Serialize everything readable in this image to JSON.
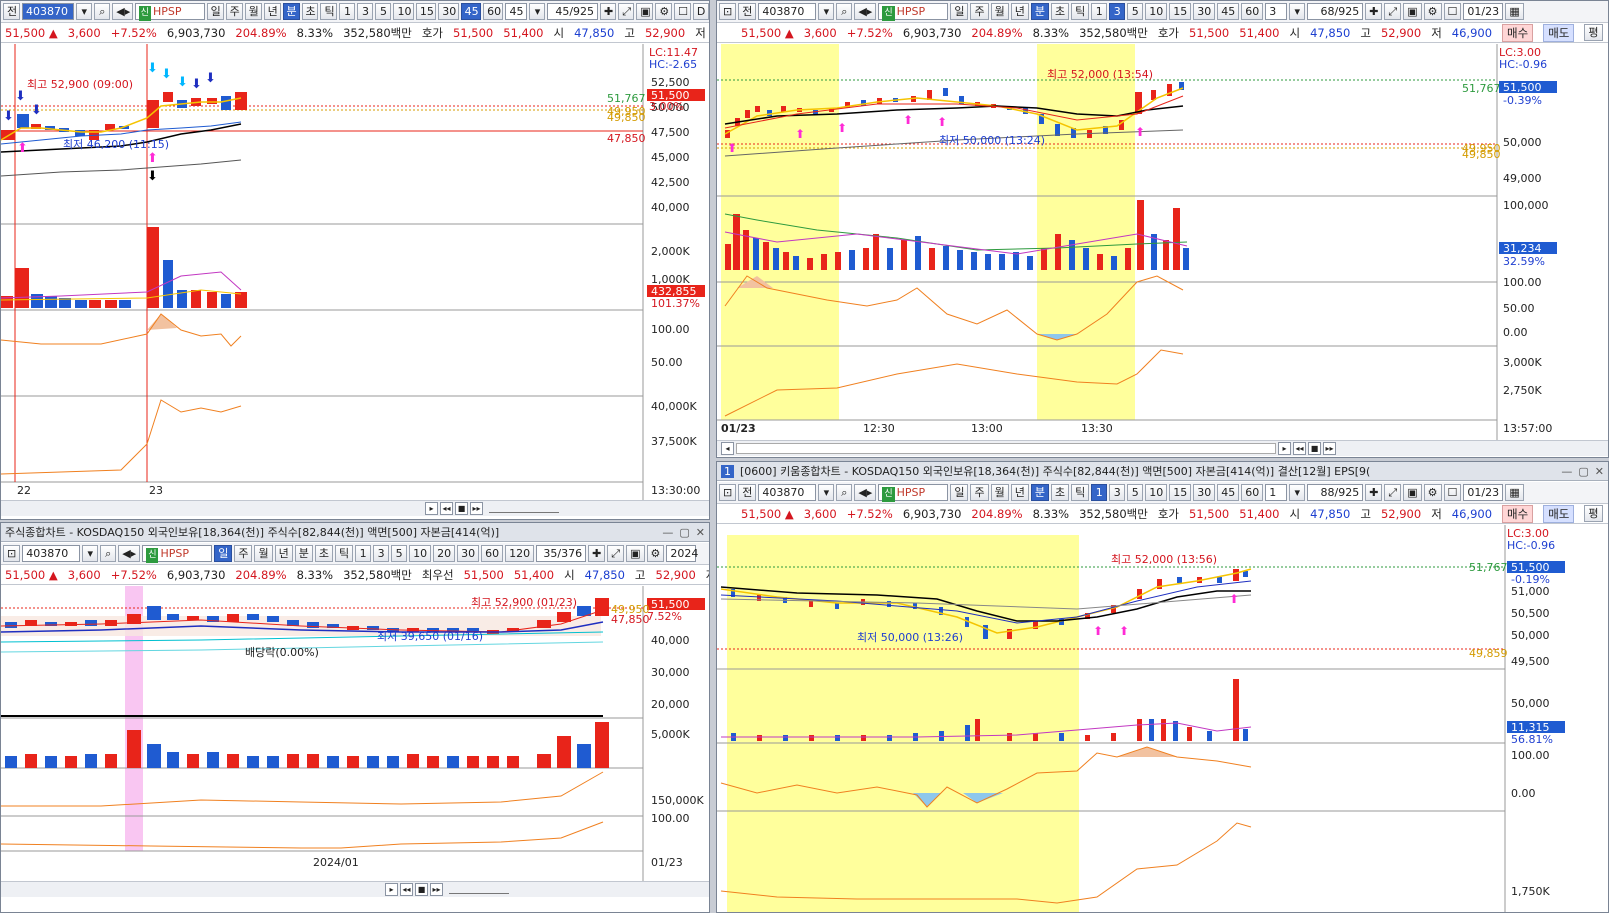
{
  "common": {
    "code": "403870",
    "name": "HPSP",
    "price": "51,500 ▲",
    "change": "3,600",
    "change_pct": "+7.52%",
    "volume": "6,903,730",
    "vol_ratio": "204.89%",
    "turnover_pct": "8.33%",
    "amount": "352,580백만",
    "quote_label": "호가",
    "best_ask": "51,500",
    "best_bid": "51,400",
    "open_label": "시",
    "open": "47,850",
    "high_label": "고",
    "high": "52,900",
    "low_label": "저",
    "low": "46,900",
    "buy": "매수",
    "sell": "매도",
    "flat": "평"
  },
  "tb": {
    "prev": "전",
    "day": "일",
    "week": "주",
    "month": "월",
    "year": "년",
    "minute": "분",
    "second": "초",
    "tick": "틱",
    "b1": "1",
    "b3": "3",
    "b5": "5",
    "b10": "10",
    "b15": "15",
    "b20": "20",
    "b30": "30",
    "b45": "45",
    "b60": "60",
    "b120": "120"
  },
  "pane_tl": {
    "interval": "45",
    "count": "45/925",
    "axis_info": [
      "LC:11.47",
      "HC:-2.65"
    ],
    "annot_high": "최고 52,900 (09:00)",
    "annot_low": "최저 46,200 (11:15)",
    "price_ticks": [
      "52,500",
      "50,000",
      "47,500",
      "45,000",
      "42,500",
      "40,000"
    ],
    "pr_labels": {
      "ma": "51,767",
      "cur": "51,500",
      "pct": "3.00%",
      "open1": "49,950",
      "open2": "49,850",
      "low": "47,850"
    },
    "vol_ticks": [
      "2,000K",
      "1,000K"
    ],
    "vol_labels": {
      "v": "432,855",
      "pct": "101.37%"
    },
    "osc_ticks": [
      "100.00",
      "50.00"
    ],
    "obv_ticks": [
      "40,000K",
      "37,500K"
    ],
    "dates": [
      "22",
      "23"
    ],
    "time": "13:30:00"
  },
  "pane_tr": {
    "interval": "3",
    "count": "68/925",
    "date": "01/23",
    "axis_info": [
      "LC:3.00",
      "HC:-0.96"
    ],
    "annot_high": "최고 52,000 (13:54)",
    "annot_low": "최저 50,000 (13:24)",
    "price_ticks": [
      "50,000",
      "49,000"
    ],
    "pr_labels": {
      "ma": "51,767",
      "cur": "51,500",
      "pct": "-0.39%",
      "l1": "49,950",
      "l2": "49,850"
    },
    "vol_ticks": [
      "100,000",
      "50,000"
    ],
    "vol_labels": {
      "v": "31,234",
      "pct": "32.59%"
    },
    "osc_ticks": [
      "100.00",
      "50.00",
      "0.00"
    ],
    "obv_ticks": [
      "3,000K",
      "2,750K"
    ],
    "xticks": [
      "01/23",
      "12:30",
      "13:00",
      "13:30"
    ],
    "time": "13:57:00"
  },
  "pane_bl": {
    "title": "주식종합차트 - KOSDAQ150 외국인보유[18,364(천)] 주식수[82,844(천)] 액면[500] 자본금[414(억)]",
    "count": "35/376",
    "year_stub": "2024",
    "priority": "최우선",
    "annot_high": "최고 52,900 (01/23)",
    "annot_low": "최저 39,650 (01/16)",
    "annot_div": "배당락(0.00%)",
    "price_ticks": [
      "40,000",
      "30,000",
      "20,000"
    ],
    "pr_labels": {
      "cur": "51,500",
      "pct": "7.52%",
      "l1": "49,950",
      "l2": "47,850"
    },
    "vol_ticks": [
      "5,000K"
    ],
    "obv_ticks": [
      "150,000K"
    ],
    "osc_ticks": [
      "100.00"
    ],
    "xticks": [
      "2024/01"
    ],
    "date": "01/23"
  },
  "pane_br": {
    "title": "[0600] 키움종합차트 - KOSDAQ150 외국인보유[18,364(천)] 주식수[82,844(천)] 액면[500] 자본금[414(억)] 결산[12월] EPS[9(",
    "screen_num": "1",
    "interval": "1",
    "count": "88/925",
    "date": "01/23",
    "axis_info": [
      "LC:3.00",
      "HC:-0.96"
    ],
    "annot_high": "최고 52,000 (13:56)",
    "annot_low": "최저 50,000 (13:26)",
    "price_ticks": [
      "51,000",
      "50,500",
      "50,000",
      "49,500"
    ],
    "pr_labels": {
      "ma": "51,767",
      "cur": "51,500",
      "pct": "-0.19%",
      "l1": "49,859"
    },
    "vol_ticks": [
      "50,000"
    ],
    "vol_labels": {
      "v": "11,315",
      "pct": "56.81%"
    },
    "osc_ticks": [
      "100.00",
      "0.00"
    ],
    "obv_ticks": [
      "1,750K"
    ]
  },
  "colors": {
    "up": "#e8241a",
    "down": "#1f5bd1",
    "highlight": "#ffff9c",
    "ma5": "#f5c400",
    "ma20": "#000000",
    "obv": "#f08020"
  }
}
